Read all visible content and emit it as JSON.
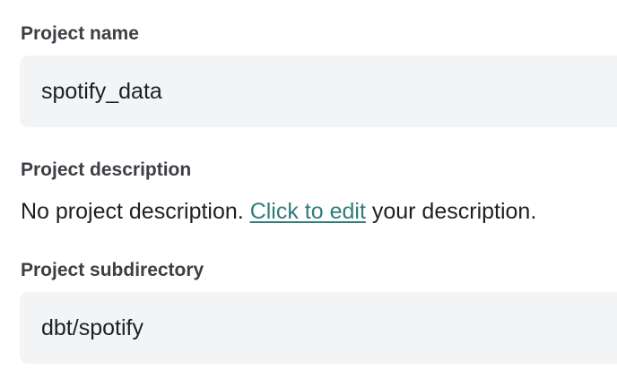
{
  "project_name": {
    "label": "Project name",
    "value": "spotify_data"
  },
  "project_description": {
    "label": "Project description",
    "text_before": "No project description. ",
    "link_text": "Click to edit",
    "text_after": " your description."
  },
  "project_subdirectory": {
    "label": "Project subdirectory",
    "value": "dbt/spotify"
  },
  "colors": {
    "link": "#2f7d7a",
    "input_background": "#f3f4f6",
    "label": "#3c3f44"
  }
}
